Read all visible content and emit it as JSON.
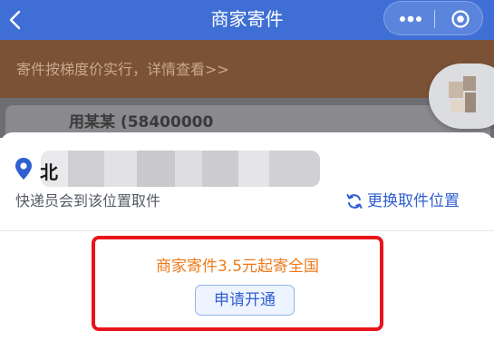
{
  "header": {
    "title": "商家寄件",
    "back_icon": "chevron-left-icon",
    "more_icon": "more-dots-icon",
    "close_icon": "target-circle-icon",
    "bg_color": "#3f6fd4"
  },
  "banner": {
    "text": "寄件按梯度价实行，详情查看>>",
    "bg_color": "#7b5236"
  },
  "background_card": {
    "text": "用某某 (58400000"
  },
  "address": {
    "leading_char": "北",
    "hint": "快递员会到该位置取件",
    "change_label": "更换取件位置",
    "pin_icon": "location-pin-icon",
    "refresh_icon": "refresh-icon"
  },
  "promo": {
    "text": "商家寄件3.5元起寄全国",
    "button_label": "申请开通",
    "highlight_color": "#e8141a",
    "text_color": "#ef7a1a"
  }
}
